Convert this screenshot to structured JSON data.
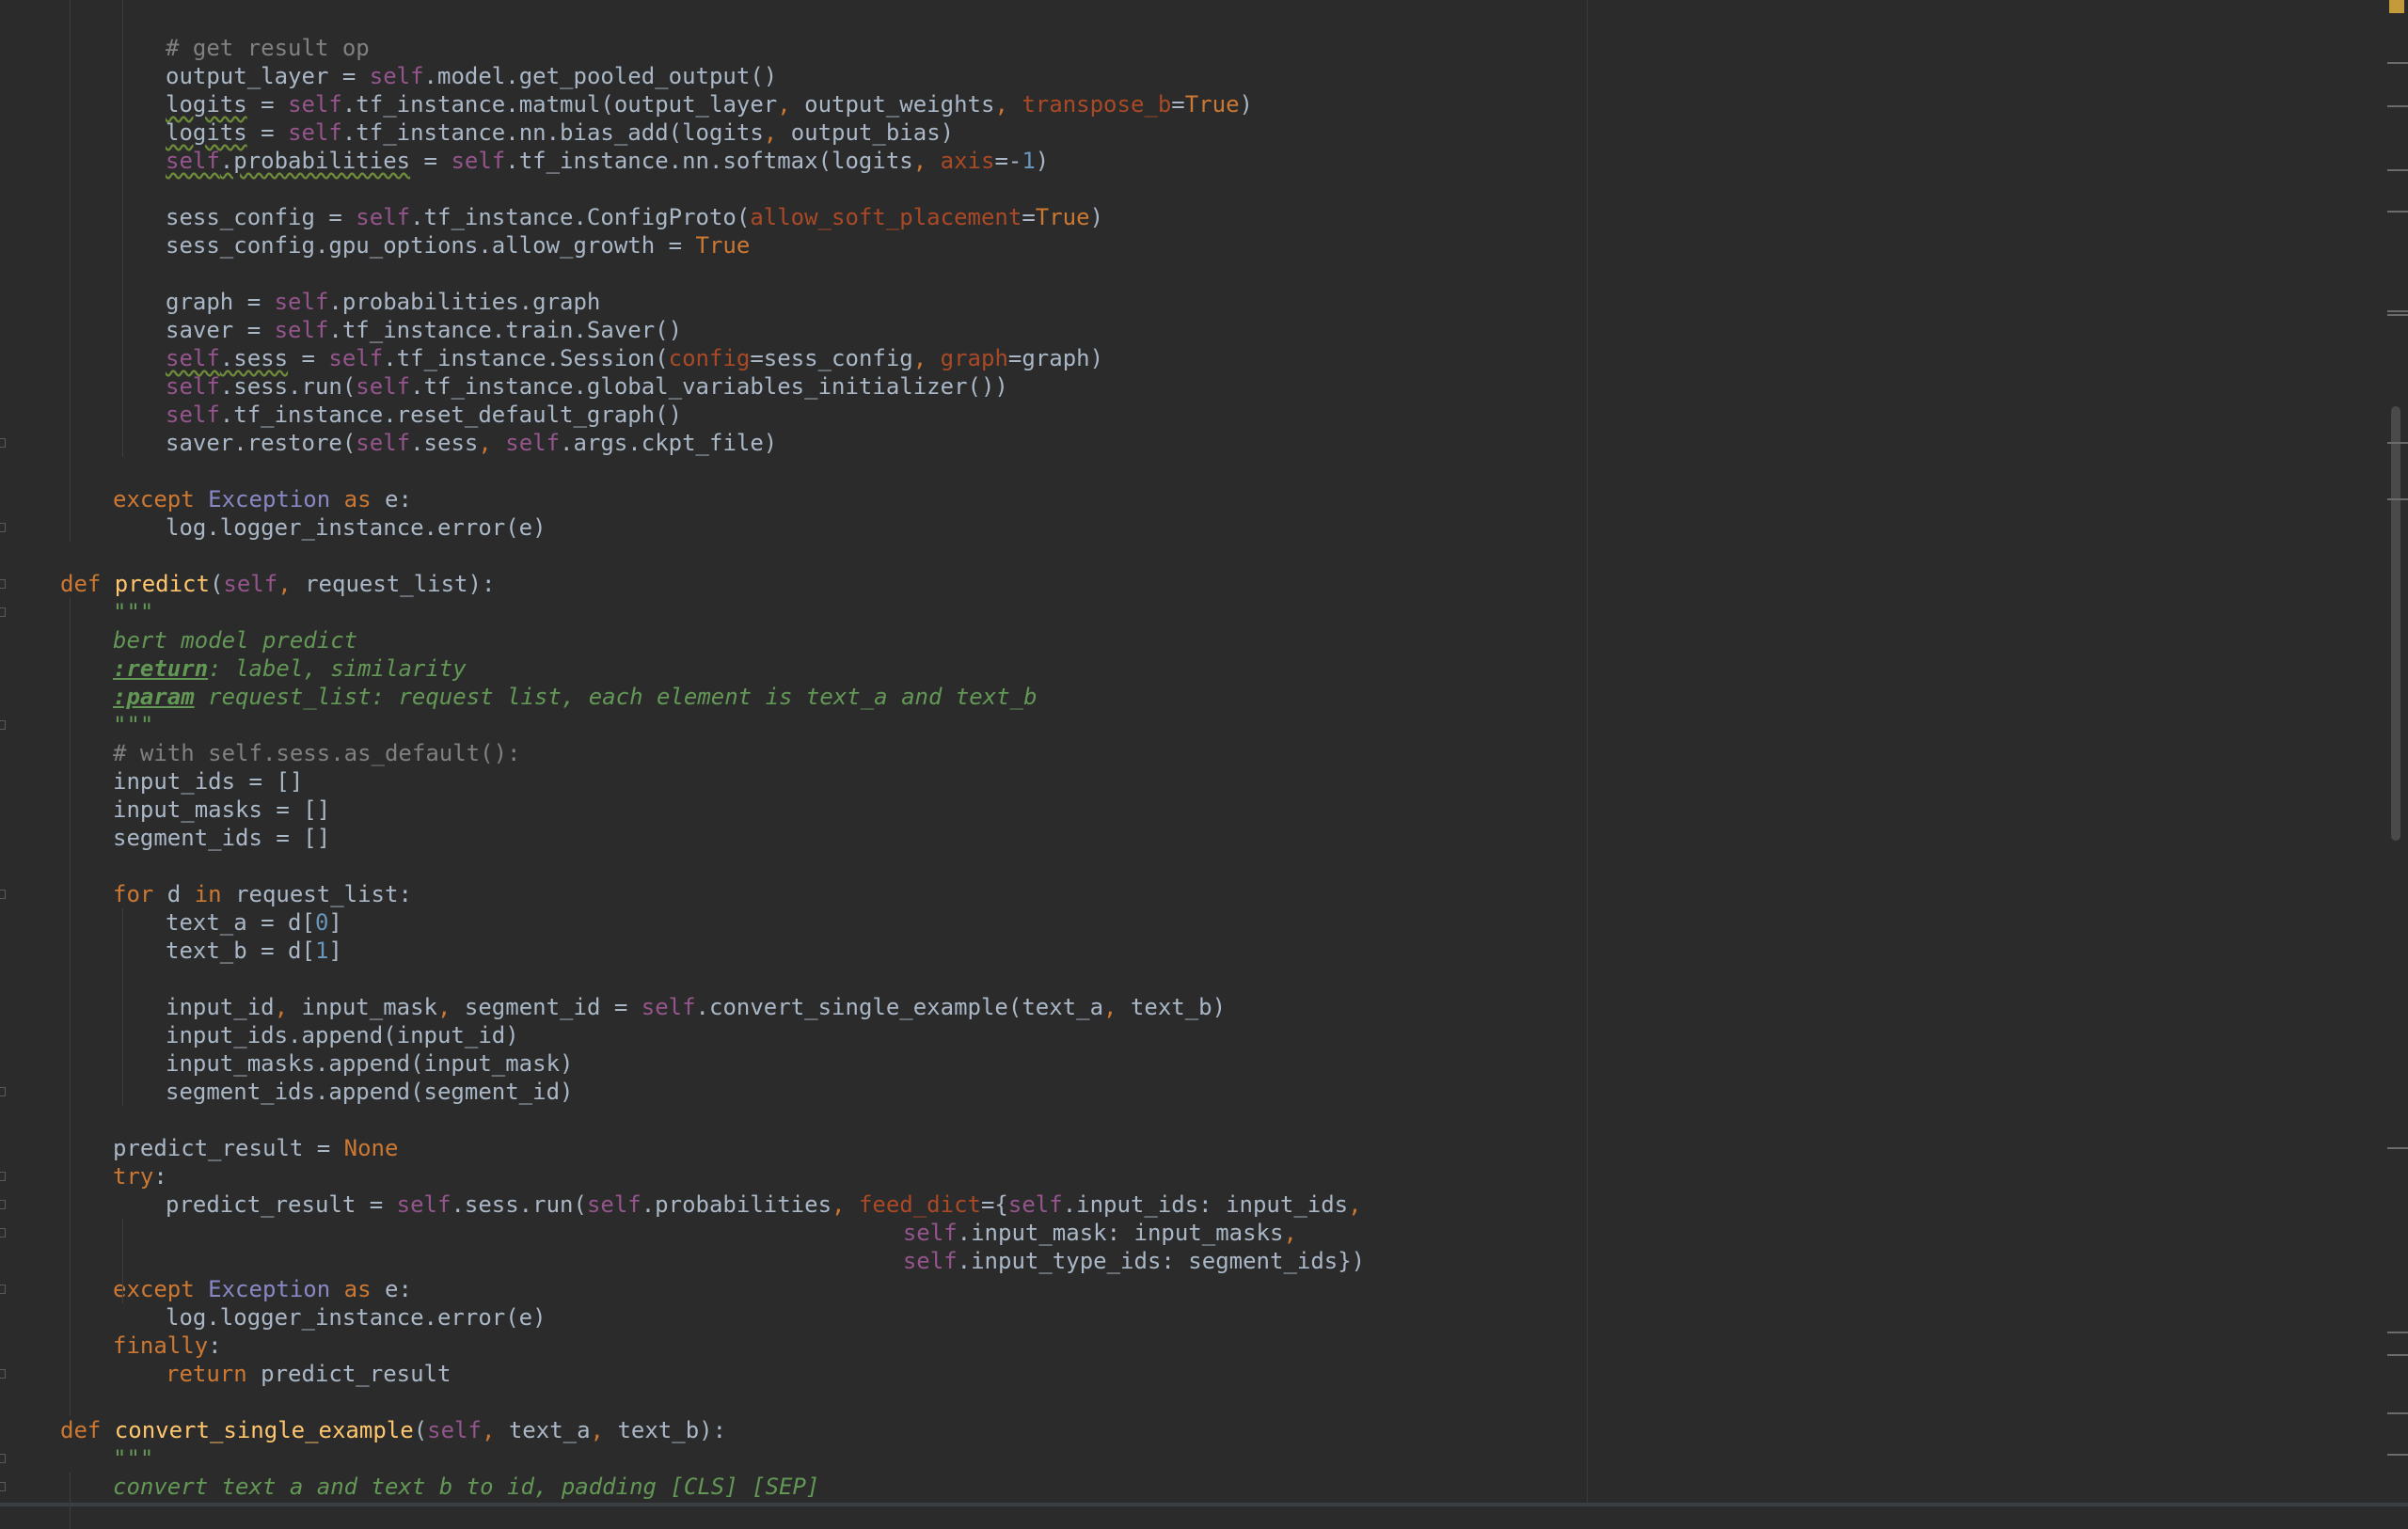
{
  "editor": {
    "language": "python",
    "colors": {
      "background": "#2b2b2b",
      "text": "#a9b7c6",
      "keyword": "#cc7832",
      "self": "#94558d",
      "comment": "#808080",
      "docstring": "#629755",
      "number": "#6897bb",
      "function": "#ffc66d",
      "builtin": "#8888c6",
      "param": "#aa4926"
    },
    "lines": [
      {
        "indent": 2,
        "tokens": [
          [
            "c",
            "# get result op"
          ]
        ]
      },
      {
        "indent": 2,
        "tokens": [
          [
            "",
            "output_layer = "
          ],
          [
            "s",
            "self"
          ],
          [
            "",
            ".model.get_pooled_output()"
          ]
        ]
      },
      {
        "indent": 2,
        "tokens": [
          [
            "u",
            "logits"
          ],
          [
            "",
            " = "
          ],
          [
            "s",
            "self"
          ],
          [
            "",
            ".tf_instance.matmul(output_layer"
          ],
          [
            "k",
            ","
          ],
          [
            "",
            " output_weights"
          ],
          [
            "k",
            ","
          ],
          [
            "",
            " "
          ],
          [
            "p",
            "transpose_b"
          ],
          [
            "",
            "="
          ],
          [
            "k",
            "True"
          ],
          [
            "",
            ")"
          ]
        ]
      },
      {
        "indent": 2,
        "tokens": [
          [
            "u",
            "logits"
          ],
          [
            "",
            " = "
          ],
          [
            "s",
            "self"
          ],
          [
            "",
            ".tf_instance.nn.bias_add(logits"
          ],
          [
            "k",
            ","
          ],
          [
            "",
            " output_bias)"
          ]
        ]
      },
      {
        "indent": 2,
        "tokens": [
          [
            "su",
            "self"
          ],
          [
            "u",
            ".probabilities"
          ],
          [
            "",
            " = "
          ],
          [
            "s",
            "self"
          ],
          [
            "",
            ".tf_instance.nn.softmax(logits"
          ],
          [
            "k",
            ","
          ],
          [
            "",
            " "
          ],
          [
            "p",
            "axis"
          ],
          [
            "",
            "=-"
          ],
          [
            "n",
            "1"
          ],
          [
            "",
            ")"
          ]
        ]
      },
      {
        "indent": 0,
        "tokens": []
      },
      {
        "indent": 2,
        "tokens": [
          [
            "",
            "sess_config = "
          ],
          [
            "s",
            "self"
          ],
          [
            "",
            ".tf_instance.ConfigProto("
          ],
          [
            "p",
            "allow_soft_placement"
          ],
          [
            "",
            "="
          ],
          [
            "k",
            "True"
          ],
          [
            "",
            ")"
          ]
        ]
      },
      {
        "indent": 2,
        "tokens": [
          [
            "",
            "sess_config.gpu_options.allow_growth = "
          ],
          [
            "k",
            "True"
          ]
        ]
      },
      {
        "indent": 0,
        "tokens": []
      },
      {
        "indent": 2,
        "tokens": [
          [
            "",
            "graph = "
          ],
          [
            "s",
            "self"
          ],
          [
            "",
            ".probabilities.graph"
          ]
        ]
      },
      {
        "indent": 2,
        "tokens": [
          [
            "",
            "saver = "
          ],
          [
            "s",
            "self"
          ],
          [
            "",
            ".tf_instance.train.Saver()"
          ]
        ]
      },
      {
        "indent": 2,
        "tokens": [
          [
            "su",
            "self"
          ],
          [
            "u",
            ".sess"
          ],
          [
            "",
            " = "
          ],
          [
            "s",
            "self"
          ],
          [
            "",
            ".tf_instance.Session("
          ],
          [
            "p",
            "config"
          ],
          [
            "",
            "=sess_config"
          ],
          [
            "k",
            ","
          ],
          [
            "",
            " "
          ],
          [
            "p",
            "graph"
          ],
          [
            "",
            "=graph)"
          ]
        ]
      },
      {
        "indent": 2,
        "tokens": [
          [
            "s",
            "self"
          ],
          [
            "",
            ".sess.run("
          ],
          [
            "s",
            "self"
          ],
          [
            "",
            ".tf_instance.global_variables_initializer())"
          ]
        ]
      },
      {
        "indent": 2,
        "tokens": [
          [
            "s",
            "self"
          ],
          [
            "",
            ".tf_instance.reset_default_graph()"
          ]
        ]
      },
      {
        "indent": 2,
        "tokens": [
          [
            "",
            "saver.restore("
          ],
          [
            "s",
            "self"
          ],
          [
            "",
            ".sess"
          ],
          [
            "k",
            ","
          ],
          [
            "",
            " "
          ],
          [
            "s",
            "self"
          ],
          [
            "",
            ".args.ckpt_file)"
          ]
        ]
      },
      {
        "indent": 0,
        "tokens": []
      },
      {
        "indent": 1,
        "tokens": [
          [
            "k",
            "except "
          ],
          [
            "b",
            "Exception"
          ],
          [
            "k",
            " as "
          ],
          [
            "",
            "e:"
          ]
        ]
      },
      {
        "indent": 2,
        "tokens": [
          [
            "",
            "log.logger_instance.error(e)"
          ]
        ]
      },
      {
        "indent": 0,
        "tokens": []
      },
      {
        "indent": 0,
        "tokens": [
          [
            "k",
            "def "
          ],
          [
            "f",
            "predict"
          ],
          [
            "",
            "("
          ],
          [
            "s",
            "self"
          ],
          [
            "k",
            ","
          ],
          [
            "",
            " request_list):"
          ]
        ]
      },
      {
        "indent": 1,
        "tokens": [
          [
            "d",
            "\"\"\""
          ]
        ]
      },
      {
        "indent": 1,
        "tokens": [
          [
            "d",
            "bert model predict"
          ]
        ]
      },
      {
        "indent": 1,
        "tokens": [
          [
            "t",
            ":return"
          ],
          [
            "d",
            ": label, similarity"
          ]
        ]
      },
      {
        "indent": 1,
        "tokens": [
          [
            "t",
            ":param"
          ],
          [
            "d",
            " request_list: request list, each element is text_a and text_b"
          ]
        ]
      },
      {
        "indent": 1,
        "tokens": [
          [
            "d",
            "\"\"\""
          ]
        ]
      },
      {
        "indent": 1,
        "tokens": [
          [
            "c",
            "# with self.sess.as_default():"
          ]
        ]
      },
      {
        "indent": 1,
        "tokens": [
          [
            "",
            "input_ids = []"
          ]
        ]
      },
      {
        "indent": 1,
        "tokens": [
          [
            "",
            "input_masks = []"
          ]
        ]
      },
      {
        "indent": 1,
        "tokens": [
          [
            "",
            "segment_ids = []"
          ]
        ]
      },
      {
        "indent": 0,
        "tokens": []
      },
      {
        "indent": 1,
        "tokens": [
          [
            "k",
            "for "
          ],
          [
            "",
            "d "
          ],
          [
            "k",
            "in "
          ],
          [
            "",
            "request_list:"
          ]
        ]
      },
      {
        "indent": 2,
        "tokens": [
          [
            "",
            "text_a = d["
          ],
          [
            "n",
            "0"
          ],
          [
            "",
            "]"
          ]
        ]
      },
      {
        "indent": 2,
        "tokens": [
          [
            "",
            "text_b = d["
          ],
          [
            "n",
            "1"
          ],
          [
            "",
            "]"
          ]
        ]
      },
      {
        "indent": 0,
        "tokens": []
      },
      {
        "indent": 2,
        "tokens": [
          [
            "",
            "input_id"
          ],
          [
            "k",
            ","
          ],
          [
            "",
            " input_mask"
          ],
          [
            "k",
            ","
          ],
          [
            "",
            " segment_id = "
          ],
          [
            "s",
            "self"
          ],
          [
            "",
            ".convert_single_example(text_a"
          ],
          [
            "k",
            ","
          ],
          [
            "",
            " text_b)"
          ]
        ]
      },
      {
        "indent": 2,
        "tokens": [
          [
            "",
            "input_ids.append(input_id)"
          ]
        ]
      },
      {
        "indent": 2,
        "tokens": [
          [
            "",
            "input_masks.append(input_mask)"
          ]
        ]
      },
      {
        "indent": 2,
        "tokens": [
          [
            "",
            "segment_ids.append(segment_id)"
          ]
        ]
      },
      {
        "indent": 0,
        "tokens": []
      },
      {
        "indent": 1,
        "tokens": [
          [
            "",
            "predict_result = "
          ],
          [
            "k",
            "None"
          ]
        ]
      },
      {
        "indent": 1,
        "tokens": [
          [
            "k",
            "try"
          ],
          [
            "",
            ":"
          ]
        ]
      },
      {
        "indent": 2,
        "tokens": [
          [
            "",
            "predict_result = "
          ],
          [
            "s",
            "self"
          ],
          [
            "",
            ".sess.run("
          ],
          [
            "s",
            "self"
          ],
          [
            "",
            ".probabilities"
          ],
          [
            "k",
            ","
          ],
          [
            "",
            " "
          ],
          [
            "p",
            "feed_dict"
          ],
          [
            "",
            "={"
          ],
          [
            "s",
            "self"
          ],
          [
            "",
            ".input_ids: input_ids"
          ],
          [
            "k",
            ","
          ]
        ]
      },
      {
        "indent": 0,
        "tokens": [
          [
            "",
            "                                                              "
          ],
          [
            "s",
            "self"
          ],
          [
            "",
            ".input_mask: input_masks"
          ],
          [
            "k",
            ","
          ]
        ]
      },
      {
        "indent": 0,
        "tokens": [
          [
            "",
            "                                                              "
          ],
          [
            "s",
            "self"
          ],
          [
            "",
            ".input_type_ids: segment_ids})"
          ]
        ]
      },
      {
        "indent": 1,
        "tokens": [
          [
            "k",
            "except "
          ],
          [
            "b",
            "Exception"
          ],
          [
            "k",
            " as "
          ],
          [
            "",
            "e:"
          ]
        ]
      },
      {
        "indent": 2,
        "tokens": [
          [
            "",
            "log.logger_instance.error(e)"
          ]
        ]
      },
      {
        "indent": 1,
        "tokens": [
          [
            "k",
            "finally"
          ],
          [
            "",
            ":"
          ]
        ]
      },
      {
        "indent": 2,
        "tokens": [
          [
            "k",
            "return "
          ],
          [
            "",
            "predict_result"
          ]
        ]
      },
      {
        "indent": 0,
        "tokens": []
      },
      {
        "indent": 0,
        "tokens": [
          [
            "k",
            "def "
          ],
          [
            "f",
            "convert_single_example"
          ],
          [
            "",
            "("
          ],
          [
            "s",
            "self"
          ],
          [
            "k",
            ","
          ],
          [
            "",
            " text_a"
          ],
          [
            "k",
            ","
          ],
          [
            "",
            " text_b):"
          ]
        ]
      },
      {
        "indent": 1,
        "tokens": [
          [
            "d",
            "\"\"\""
          ]
        ]
      },
      {
        "indent": 1,
        "tokens": [
          [
            "d",
            "convert text a and text b to id, padding [CLS] [SEP]"
          ]
        ]
      }
    ]
  },
  "scrollbar": {
    "thumb_color": "#4a4a4a",
    "marker_color": "#6b6b6b",
    "top_marker_color": "#c49a3a"
  }
}
